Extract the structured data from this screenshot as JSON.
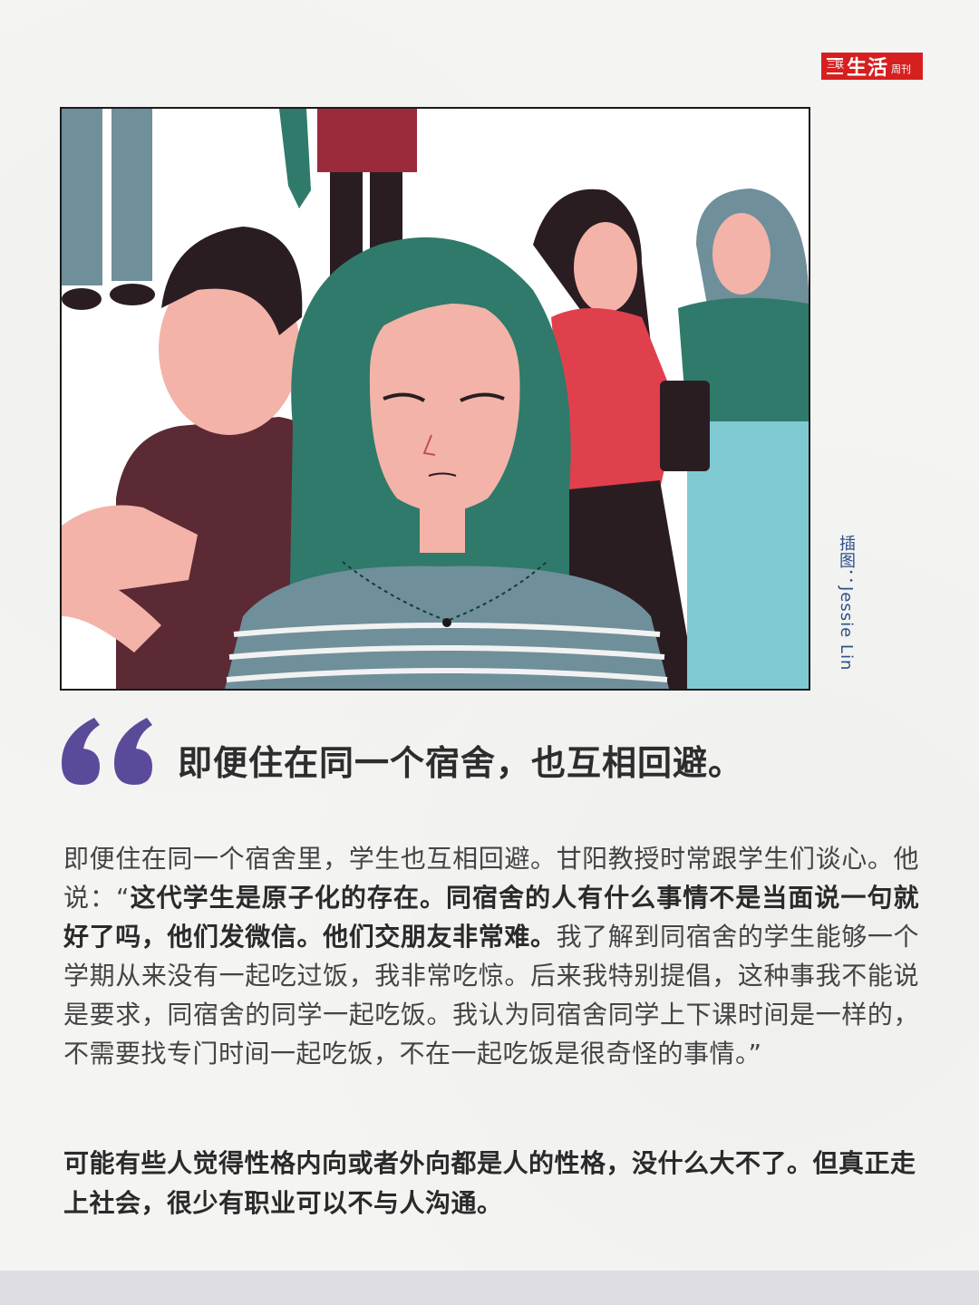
{
  "brand": {
    "logo_mark": "三联",
    "logo_main": "生活",
    "logo_sub": "周刊",
    "color": "#d62020"
  },
  "illustration": {
    "credit": "插图：Jessie Lin",
    "palette": {
      "teal": "#2f7a6a",
      "skin": "#f3b3a8",
      "maroon": "#5b2a34",
      "red": "#e0404c",
      "light_blue": "#7ec9d2",
      "dark": "#2a1d22"
    }
  },
  "quote": {
    "icon": "quote-open-icon",
    "color": "#5b4a9a",
    "headline": "即便住在同一个宿舍，也互相回避。"
  },
  "body": {
    "p1_intro": "即便住在同一个宿舍里，学生也互相回避。甘阳教授时常跟学生们谈心。他说：“",
    "p1_bold": "这代学生是原子化的存在。同宿舍的人有什么事情不是当面说一句就好了吗，他们发微信。他们交朋友非常难。",
    "p1_rest": "我了解到同宿舍的学生能够一个学期从来没有一起吃过饭，我非常吃惊。后来我特别提倡，这种事我不能说是要求，同宿舍的同学一起吃饭。我认为同宿舍同学上下课时间是一样的，不需要找专门时间一起吃饭，不在一起吃饭是很奇怪的事情。”",
    "p2": "可能有些人觉得性格内向或者外向都是人的性格，没什么大不了。但真正走上社会，很少有职业可以不与人沟通。"
  }
}
